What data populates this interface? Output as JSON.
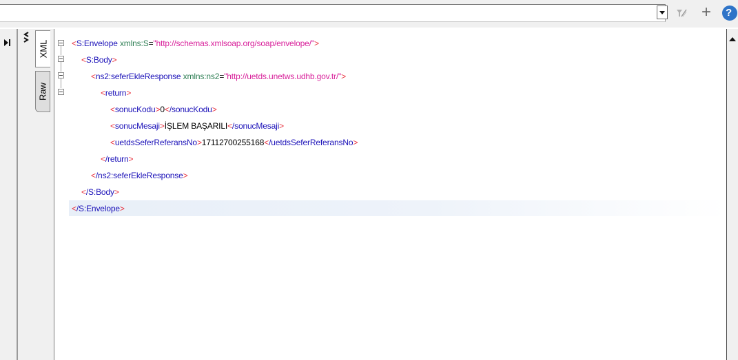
{
  "toolbar": {
    "address_value": "",
    "dropdown_icon": "chevron-down-icon",
    "filter_icon": "filter-icon",
    "add_icon": "plus-icon",
    "help_icon": "help-icon"
  },
  "tabs": [
    {
      "label": "XML",
      "active": true
    },
    {
      "label": "Raw",
      "active": false
    }
  ],
  "xml": {
    "envelope_open": "S:Envelope",
    "envelope_attr": "xmlns:S",
    "envelope_value": "\"http://schemas.xmlsoap.org/soap/envelope/\"",
    "body_open": "S:Body",
    "response_open": "ns2:seferEkleResponse",
    "response_attr": "xmlns:ns2",
    "response_value": "\"http://uetds.unetws.udhb.gov.tr/\"",
    "return_open": "return",
    "sonucKodu_tag": "sonucKodu",
    "sonucKodu_value": "0",
    "sonucKodu_close": "/sonucKodu",
    "sonucMesaji_tag": "sonucMesaji",
    "sonucMesaji_value": "İŞLEM BAŞARILI",
    "sonucMesaji_close": "/sonucMesaji",
    "ref_tag": "uetdsSeferReferansNo",
    "ref_value": "17112700255168",
    "ref_close": "/uetdsSeferReferansNo",
    "return_close": "/return",
    "response_close": "/ns2:seferEkleResponse",
    "body_close": "/S:Body",
    "envelope_close": "/S:Envelope"
  },
  "colors": {
    "bracket": "#e8323e",
    "tag": "#1a10b8",
    "attribute": "#2f7f55",
    "attribute_value": "#d8209a",
    "highlight": "#e8eff8"
  }
}
